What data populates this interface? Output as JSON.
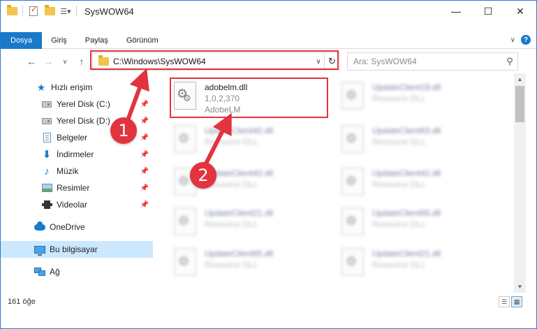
{
  "window": {
    "title": "SysWOW64",
    "controls": {
      "minimize": "—",
      "maximize": "☐",
      "close": "✕"
    }
  },
  "ribbon": {
    "tabs": [
      {
        "label": "Dosya",
        "active": true
      },
      {
        "label": "Giriş"
      },
      {
        "label": "Paylaş"
      },
      {
        "label": "Görünüm"
      }
    ],
    "help": "?"
  },
  "navigation": {
    "address": "C:\\Windows\\SysWOW64",
    "search_placeholder": "Ara: SysWOW64"
  },
  "sidebar": {
    "items": [
      {
        "label": "Hızlı erişim",
        "icon": "star-icon"
      },
      {
        "label": "Yerel Disk (C:)",
        "icon": "drive-icon",
        "pinned": true
      },
      {
        "label": "Yerel Disk (D:)",
        "icon": "drive-icon",
        "pinned": true
      },
      {
        "label": "Belgeler",
        "icon": "documents-icon",
        "pinned": true
      },
      {
        "label": "İndirmeler",
        "icon": "download-icon",
        "pinned": true
      },
      {
        "label": "Müzik",
        "icon": "music-icon",
        "pinned": true
      },
      {
        "label": "Resimler",
        "icon": "pictures-icon",
        "pinned": true
      },
      {
        "label": "Videolar",
        "icon": "videos-icon",
        "pinned": true
      },
      {
        "label": "OneDrive",
        "icon": "onedrive-icon"
      },
      {
        "label": "Bu bilgisayar",
        "icon": "computer-icon",
        "selected": true
      },
      {
        "label": "Ağ",
        "icon": "network-icon"
      }
    ]
  },
  "files": [
    {
      "name": "adobelm.dll",
      "line2": "1,0,2,370",
      "line3": "AdobeLM"
    },
    {
      "name": "UpdateClient19.dll",
      "line2": "Resource DLL"
    },
    {
      "name": "UpdateClient42.dll",
      "line2": "Resource DLL"
    },
    {
      "name": "UpdateClient63.dll",
      "line2": "Resource DLL"
    },
    {
      "name": "UpdateClient42.dll",
      "line2": "Resource DLL"
    },
    {
      "name": "UpdateClient42.dll",
      "line2": "Resource DLL"
    },
    {
      "name": "UpdateClient21.dll",
      "line2": "Resource DLL"
    },
    {
      "name": "UpdateClient65.dll",
      "line2": "Resource DLL"
    },
    {
      "name": "UpdateClient65.dll",
      "line2": "Resource DLL"
    },
    {
      "name": "UpdateClient21.dll",
      "line2": "Resource DLL"
    }
  ],
  "status": {
    "count": "161 öğe"
  },
  "annotations": {
    "badge1": "1",
    "badge2": "2",
    "color": "#e2333f"
  }
}
